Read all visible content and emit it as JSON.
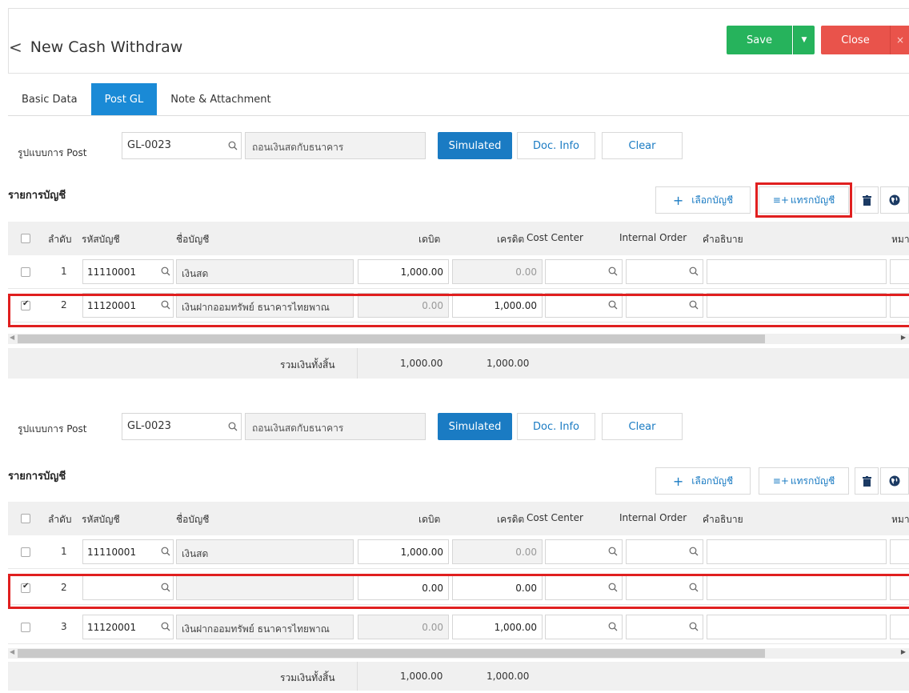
{
  "header": {
    "back_symbol": "<",
    "title": "New Cash Withdraw",
    "save_label": "Save",
    "close_label": "Close",
    "close_x": "×",
    "caret": "▼"
  },
  "tabs": [
    {
      "label": "Basic Data",
      "active": false
    },
    {
      "label": "Post GL",
      "active": true
    },
    {
      "label": "Note & Attachment",
      "active": false
    }
  ],
  "post": {
    "label": "รูปแบบการ Post",
    "code": "GL-0023",
    "description": "ถอนเงินสดกับธนาคาร",
    "simulated_label": "Simulated",
    "docinfo_label": "Doc. Info",
    "clear_label": "Clear"
  },
  "accounts": {
    "section_title": "รายการบัญชี",
    "pick_label": "เลือกบัญชี",
    "pick_symbol": "+",
    "insert_label": "แทรกบัญชี",
    "insert_symbol": "≡+"
  },
  "columns": {
    "seq": "ลำดับ",
    "account_code": "รหัสบัญชี",
    "account_name": "ชื่อบัญชี",
    "debit": "เดบิต",
    "credit": "เครดิต",
    "cost_center": "Cost Center",
    "internal_order": "Internal Order",
    "description": "คำอธิบาย",
    "note": "หมา"
  },
  "table1": {
    "rows": [
      {
        "seq": "1",
        "code": "11110001",
        "name": "เงินสด",
        "debit": "1,000.00",
        "credit": "0.00",
        "checked": false
      },
      {
        "seq": "2",
        "code": "11120001",
        "name": "เงินฝากออมทรัพย์ ธนาคารไทยพาณ",
        "debit": "0.00",
        "credit": "1,000.00",
        "checked": true
      }
    ],
    "total_label": "รวมเงินทั้งสิ้น",
    "total_debit": "1,000.00",
    "total_credit": "1,000.00"
  },
  "table2": {
    "rows": [
      {
        "seq": "1",
        "code": "11110001",
        "name": "เงินสด",
        "debit": "1,000.00",
        "credit": "0.00",
        "checked": false
      },
      {
        "seq": "2",
        "code": "",
        "name": "",
        "debit": "0.00",
        "credit": "0.00",
        "checked": true
      },
      {
        "seq": "3",
        "code": "11120001",
        "name": "เงินฝากออมทรัพย์ ธนาคารไทยพาณ",
        "debit": "0.00",
        "credit": "1,000.00",
        "checked": false
      }
    ],
    "total_label": "รวมเงินทั้งสิ้น",
    "total_debit": "1,000.00",
    "total_credit": "1,000.00"
  },
  "colors": {
    "save": "#26b35c",
    "close": "#e9534b",
    "tab_active": "#1a8ad6",
    "primary": "#1a7bc3",
    "highlight": "#e01f1f"
  }
}
